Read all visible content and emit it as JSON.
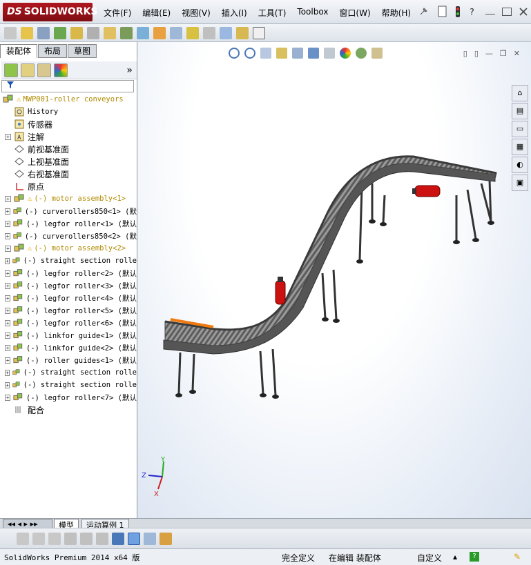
{
  "app": {
    "brand": "SOLIDWORKS",
    "brand_prefix": "DS"
  },
  "menu": [
    "文件(F)",
    "编辑(E)",
    "视图(V)",
    "插入(I)",
    "工具(T)",
    "Toolbox",
    "窗口(W)",
    "帮助(H)"
  ],
  "panel_tabs": [
    "装配体",
    "布局",
    "草图"
  ],
  "tree": {
    "root": "MWP001-roller conveyors",
    "items": [
      {
        "label": "History",
        "expandable": false,
        "icon": "history-icon",
        "warn": false,
        "prefix": ""
      },
      {
        "label": "传感器",
        "expandable": false,
        "icon": "sensor-icon",
        "warn": false,
        "prefix": ""
      },
      {
        "label": "注解",
        "expandable": true,
        "icon": "annotation-icon",
        "warn": false,
        "prefix": ""
      },
      {
        "label": "前视基准面",
        "expandable": false,
        "icon": "plane-icon",
        "warn": false,
        "prefix": ""
      },
      {
        "label": "上视基准面",
        "expandable": false,
        "icon": "plane-icon",
        "warn": false,
        "prefix": ""
      },
      {
        "label": "右视基准面",
        "expandable": false,
        "icon": "plane-icon",
        "warn": false,
        "prefix": ""
      },
      {
        "label": "原点",
        "expandable": false,
        "icon": "origin-icon",
        "warn": false,
        "prefix": ""
      },
      {
        "label": "motor assembly<1>",
        "expandable": true,
        "icon": "assembly-icon",
        "warn": true,
        "prefix": "(-)"
      },
      {
        "label": "curverollers850<1> (默",
        "expandable": true,
        "icon": "assembly-icon",
        "warn": false,
        "prefix": "(-)"
      },
      {
        "label": "legfor roller<1> (默认",
        "expandable": true,
        "icon": "assembly-icon",
        "warn": false,
        "prefix": "(-)"
      },
      {
        "label": "curverollers850<2> (默",
        "expandable": true,
        "icon": "assembly-icon",
        "warn": false,
        "prefix": "(-)"
      },
      {
        "label": "motor assembly<2>",
        "expandable": true,
        "icon": "assembly-icon",
        "warn": true,
        "prefix": "(-)"
      },
      {
        "label": "straight section rolle",
        "expandable": true,
        "icon": "assembly-icon",
        "warn": false,
        "prefix": "(-)"
      },
      {
        "label": "legfor roller<2> (默认",
        "expandable": true,
        "icon": "assembly-icon",
        "warn": false,
        "prefix": "(-)"
      },
      {
        "label": "legfor roller<3> (默认",
        "expandable": true,
        "icon": "assembly-icon",
        "warn": false,
        "prefix": "(-)"
      },
      {
        "label": "legfor roller<4> (默认",
        "expandable": true,
        "icon": "assembly-icon",
        "warn": false,
        "prefix": "(-)"
      },
      {
        "label": "legfor roller<5> (默认",
        "expandable": true,
        "icon": "assembly-icon",
        "warn": false,
        "prefix": "(-)"
      },
      {
        "label": "legfor roller<6> (默认",
        "expandable": true,
        "icon": "assembly-icon",
        "warn": false,
        "prefix": "(-)"
      },
      {
        "label": "linkfor guide<1> (默认",
        "expandable": true,
        "icon": "assembly-icon",
        "warn": false,
        "prefix": "(-)"
      },
      {
        "label": "linkfor guide<2> (默认",
        "expandable": true,
        "icon": "assembly-icon",
        "warn": false,
        "prefix": "(-)"
      },
      {
        "label": "roller guides<1> (默认",
        "expandable": true,
        "icon": "assembly-icon",
        "warn": false,
        "prefix": "(-)"
      },
      {
        "label": "straight section rolle",
        "expandable": true,
        "icon": "assembly-icon",
        "warn": false,
        "prefix": "(-)"
      },
      {
        "label": "straight section rolle",
        "expandable": true,
        "icon": "assembly-icon",
        "warn": false,
        "prefix": "(-)"
      },
      {
        "label": "legfor roller<7> (默认",
        "expandable": true,
        "icon": "assembly-icon",
        "warn": false,
        "prefix": "(-)"
      },
      {
        "label": "配合",
        "expandable": false,
        "icon": "mates-icon",
        "warn": false,
        "prefix": ""
      }
    ]
  },
  "bottom_tabs": [
    "模型",
    "运动算例 1"
  ],
  "status": {
    "product": "SolidWorks Premium 2014 x64 版",
    "definition": "完全定义",
    "editing": "在编辑 装配体",
    "custom": "自定义"
  },
  "triad": {
    "x": "Z",
    "y": "Y",
    "z": "X"
  },
  "colors": {
    "brand_red": "#b0171f",
    "motor_red": "#cc1111",
    "guide_orange": "#f07a10"
  }
}
